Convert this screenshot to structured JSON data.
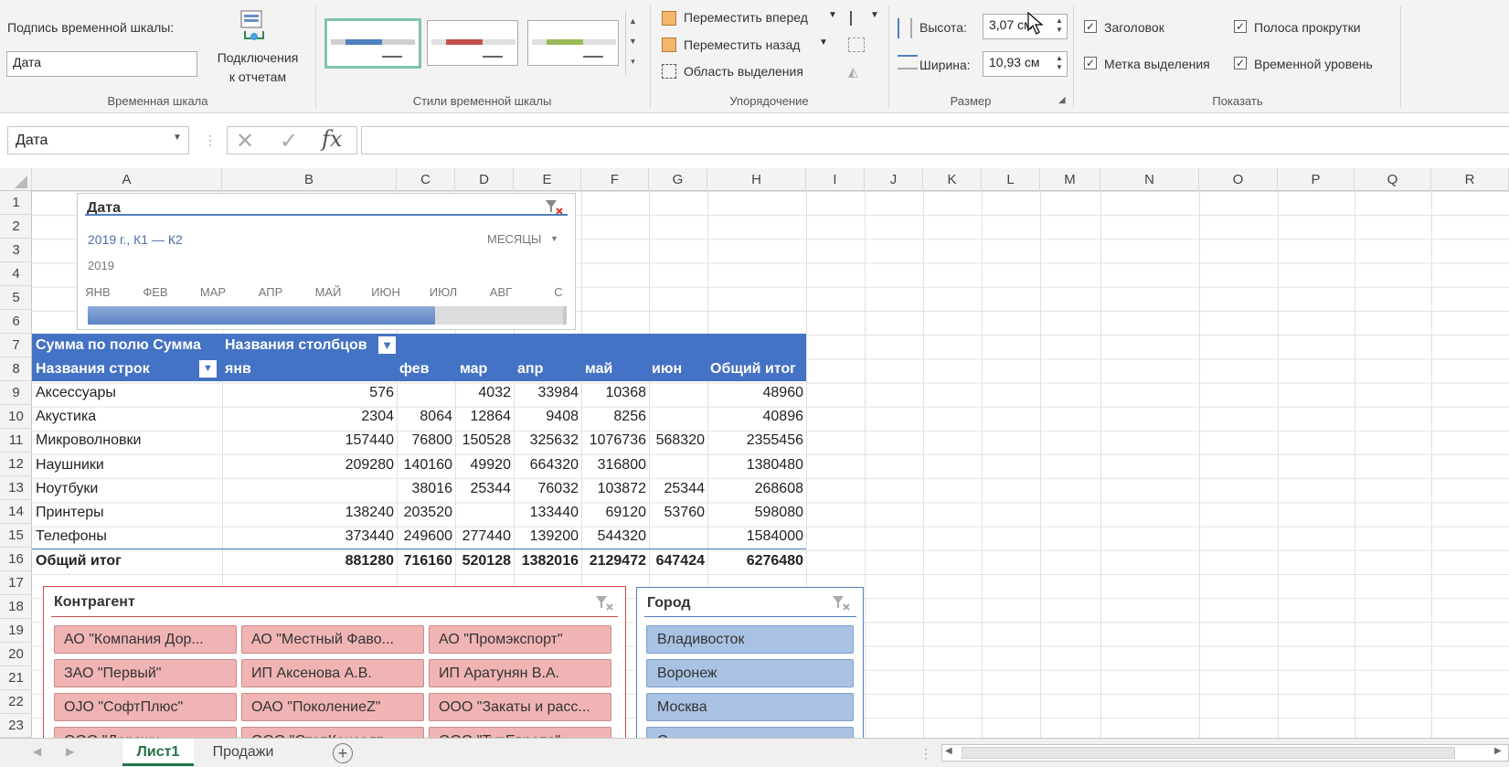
{
  "ribbon": {
    "caption_label": "Подпись временной шкалы:",
    "caption_value": "Дата",
    "connections_label_1": "Подключения",
    "connections_label_2": "к отчетам",
    "group_timeline": "Временная шкала",
    "group_styles": "Стили временной шкалы",
    "bring_forward": "Переместить вперед",
    "send_backward": "Переместить назад",
    "selection_pane": "Область выделения",
    "group_arrange": "Упорядочение",
    "height_label": "Высота:",
    "height_value": "3,07 см",
    "width_label": "Ширина:",
    "width_value": "10,93 см",
    "group_size": "Размер",
    "show_header": "Заголовок",
    "show_scrollbar": "Полоса прокрутки",
    "show_selection_label": "Метка выделения",
    "show_time_level": "Временной уровень",
    "group_show": "Показать"
  },
  "formula_bar": {
    "name_box": "Дата",
    "fx": "fx"
  },
  "columns": [
    "A",
    "B",
    "C",
    "D",
    "E",
    "F",
    "G",
    "H",
    "I",
    "J",
    "K",
    "L",
    "M",
    "N",
    "O",
    "P",
    "Q",
    "R"
  ],
  "rows": [
    "1",
    "2",
    "3",
    "4",
    "5",
    "6",
    "7",
    "8",
    "9",
    "10",
    "11",
    "12",
    "13",
    "14",
    "15",
    "16",
    "17",
    "18",
    "19",
    "20",
    "21",
    "22",
    "23"
  ],
  "timeline": {
    "title": "Дата",
    "selection": "2019 г., К1 — К2",
    "level": "МЕСЯЦЫ",
    "year": "2019",
    "months": [
      "ЯНВ",
      "ФЕВ",
      "МАР",
      "АПР",
      "МАЙ",
      "ИЮН",
      "ИЮЛ",
      "АВГ",
      "С"
    ],
    "selected_months": 6
  },
  "pivot": {
    "sum_label": "Сумма по полю Сумма",
    "col_names": "Названия столбцов",
    "row_names": "Названия строк",
    "headers": [
      "янв",
      "фев",
      "мар",
      "апр",
      "май",
      "июн",
      "Общий итог"
    ],
    "rows": [
      {
        "name": "Аксессуары",
        "v": [
          "576",
          "",
          "4032",
          "33984",
          "10368",
          "",
          "48960"
        ]
      },
      {
        "name": "Акустика",
        "v": [
          "2304",
          "8064",
          "12864",
          "9408",
          "8256",
          "",
          "40896"
        ]
      },
      {
        "name": "Микроволновки",
        "v": [
          "157440",
          "76800",
          "150528",
          "325632",
          "1076736",
          "568320",
          "2355456"
        ]
      },
      {
        "name": "Наушники",
        "v": [
          "209280",
          "140160",
          "49920",
          "664320",
          "316800",
          "",
          "1380480"
        ]
      },
      {
        "name": "Ноутбуки",
        "v": [
          "",
          "38016",
          "25344",
          "76032",
          "103872",
          "25344",
          "268608"
        ]
      },
      {
        "name": "Принтеры",
        "v": [
          "138240",
          "203520",
          "",
          "133440",
          "69120",
          "53760",
          "598080"
        ]
      },
      {
        "name": "Телефоны",
        "v": [
          "373440",
          "249600",
          "277440",
          "139200",
          "544320",
          "",
          "1584000"
        ]
      }
    ],
    "total": {
      "name": "Общий итог",
      "v": [
        "881280",
        "716160",
        "520128",
        "1382016",
        "2129472",
        "647424",
        "6276480"
      ]
    }
  },
  "slicer_contractor": {
    "title": "Контрагент",
    "items": [
      "АО \"Компания Дор...",
      "АО \"Местный Фаво...",
      "АО \"Промэкспорт\"",
      "ЗАО \"Первый\"",
      "ИП Аксенова А.В.",
      "ИП Аратунян В.А.",
      "OJO \"СофтПлюс\"",
      "ОАО \"ПоколениеZ\"",
      "ООО \"Закаты и расс...",
      "ООО \"Дорожн...",
      "ООО \"СтопКонсалт...",
      "ООО \"ТурЕвропа\""
    ]
  },
  "slicer_city": {
    "title": "Город",
    "items": [
      "Владивосток",
      "Воронеж",
      "Москва",
      "С..."
    ]
  },
  "sheet_tabs": {
    "active": "Лист1",
    "other": "Продажи",
    "add": "+"
  },
  "colors": {
    "pivot_header": "#4472c4",
    "slicer_red": "#f0b4b4",
    "slicer_blue": "#a9c2e3",
    "active_tab": "#217346"
  }
}
